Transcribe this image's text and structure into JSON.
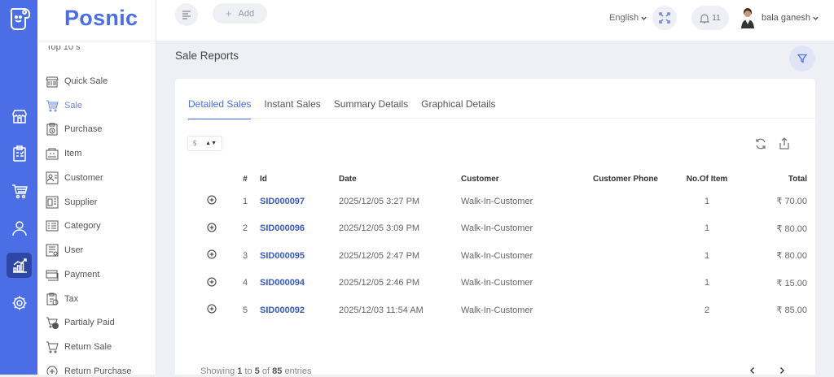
{
  "app": {
    "brand": "Posnic"
  },
  "rail": {
    "logo_icon": "happy-tag-icon",
    "items": [
      {
        "icon": "store-icon",
        "active": false
      },
      {
        "icon": "clipboard-icon",
        "active": false
      },
      {
        "icon": "cart-icon",
        "active": false
      },
      {
        "icon": "user-icon",
        "active": false
      },
      {
        "icon": "chart-icon",
        "active": true
      },
      {
        "icon": "gear-icon",
        "active": false
      }
    ]
  },
  "sidebar": {
    "cut_label": "Top 10 s",
    "items": [
      {
        "label": "Quick Sale",
        "icon": "quick-sale-icon",
        "active": false
      },
      {
        "label": "Sale",
        "icon": "cart-icon",
        "active": true
      },
      {
        "label": "Purchase",
        "icon": "purchase-icon",
        "active": false
      },
      {
        "label": "Item",
        "icon": "item-icon",
        "active": false
      },
      {
        "label": "Customer",
        "icon": "customer-icon",
        "active": false
      },
      {
        "label": "Supplier",
        "icon": "supplier-icon",
        "active": false
      },
      {
        "label": "Category",
        "icon": "category-icon",
        "active": false
      },
      {
        "label": "User",
        "icon": "user-icon",
        "active": false
      },
      {
        "label": "Payment",
        "icon": "payment-icon",
        "active": false
      },
      {
        "label": "Tax",
        "icon": "tax-icon",
        "active": false
      },
      {
        "label": "Partialy Paid",
        "icon": "partially-paid-icon",
        "active": false
      },
      {
        "label": "Return Sale",
        "icon": "return-sale-icon",
        "active": false
      },
      {
        "label": "Return Purchase",
        "icon": "return-purchase-icon",
        "active": false
      }
    ]
  },
  "topbar": {
    "add_label": "Add",
    "language": "English",
    "notification_count": "11",
    "user_name": "bala ganesh"
  },
  "page": {
    "title": "Sale Reports",
    "tabs": [
      {
        "label": "Detailed Sales",
        "active": true
      },
      {
        "label": "Instant Sales",
        "active": false
      },
      {
        "label": "Summary Details",
        "active": false
      },
      {
        "label": "Graphical Details",
        "active": false
      }
    ],
    "page_size": "5"
  },
  "table": {
    "columns": [
      "",
      "#",
      "Id",
      "Date",
      "Customer",
      "Customer Phone",
      "No.Of Item",
      "Total"
    ],
    "rows": [
      {
        "n": "1",
        "id": "SID000097",
        "date": "2025/12/05 3:27 PM",
        "customer": "Walk-In-Customer",
        "phone": "",
        "items": "1",
        "total": "₹ 70.00"
      },
      {
        "n": "2",
        "id": "SID000096",
        "date": "2025/12/05 3:09 PM",
        "customer": "Walk-In-Customer",
        "phone": "",
        "items": "1",
        "total": "₹ 80.00"
      },
      {
        "n": "3",
        "id": "SID000095",
        "date": "2025/12/05 2:47 PM",
        "customer": "Walk-In-Customer",
        "phone": "",
        "items": "1",
        "total": "₹ 80.00"
      },
      {
        "n": "4",
        "id": "SID000094",
        "date": "2025/12/05 2:46 PM",
        "customer": "Walk-In-Customer",
        "phone": "",
        "items": "1",
        "total": "₹ 15.00"
      },
      {
        "n": "5",
        "id": "SID000092",
        "date": "2025/12/03 11:54 AM",
        "customer": "Walk-In-Customer",
        "phone": "",
        "items": "2",
        "total": "₹ 85.00"
      }
    ]
  },
  "footer": {
    "showing": "Showing",
    "from": "1",
    "to_word": "to",
    "to": "5",
    "of_word": "of",
    "total": "85",
    "entries": "entries"
  },
  "colors": {
    "accent": "#4b6ee6",
    "rail": "#4b6ee6",
    "rail_active": "#2c47a5",
    "id_link": "#3a5bb8"
  }
}
